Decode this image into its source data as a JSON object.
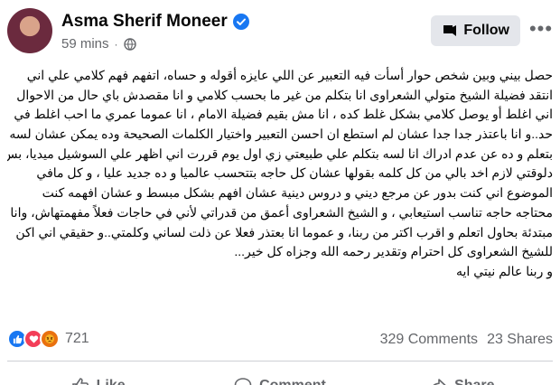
{
  "post": {
    "author": "Asma Sherif Moneer",
    "time": "59 mins",
    "follow_label": "Follow",
    "lines": [
      "حصل بيني وبين شخص حوار أسأت فيه التعبير عن اللي عايزه أقوله و حساه، اتفهم فهم كلامي علي اني",
      "انتقد فضيلة الشيخ متولي الشعراوى انا بتكلم من غير ما بحسب كلامي و انا مقصدش باي حال من الاحوال",
      "اني اغلط أو يوصل كلامي بشكل غلط كده ، انا مش بقيم فضيلة الامام ، انا عموما عمري ما احب اغلط في",
      "حد..و انا باعتذر جدا جدا عشان لم استطع ان احسن التعبير واختيار الكلمات الصحيحة وده يمكن عشان لسه",
      "بتعلم و ده عن عدم ادراك انا لسه بتكلم علي طبيعتي زي اول يوم قررت اني اظهر علي السوشيل ميديا، بس",
      "دلوقتي لازم اخد بالي من كل كلمه بقولها عشان كل حاجه بتتحسب عالميا و ده جديد عليا ، و كل مافي",
      "الموضوع اني كنت بدور عن مرجع ديني و دروس دينية عشان افهم بشكل مبسط و عشان افهمه كنت",
      "محتاجه حاجه تناسب استيعابي ، و الشيخ الشعراوى أعمق من قدراتي لأني في حاجات فعلاً مفهمتهاش، وانا",
      "مبتدئة بحاول اتعلم و اقرب اكتر من ربنا، و عموما انا بعتذر فعلا عن ذلت لساني وكلمتي..و حقيقي اني اكن",
      "للشيخ الشعراوى كل احترام وتقدير رحمه الله وجزاه كل خير...",
      "و ربنا عالم نيتي ايه"
    ]
  },
  "stats": {
    "reaction_count": "721",
    "comments": "329 Comments",
    "shares": "23 Shares"
  },
  "actions": {
    "like": "Like",
    "comment": "Comment",
    "share": "Share"
  },
  "colors": {
    "facebook_blue": "#1877f2",
    "muted_text": "#65676b",
    "button_bg": "#e4e6eb"
  }
}
